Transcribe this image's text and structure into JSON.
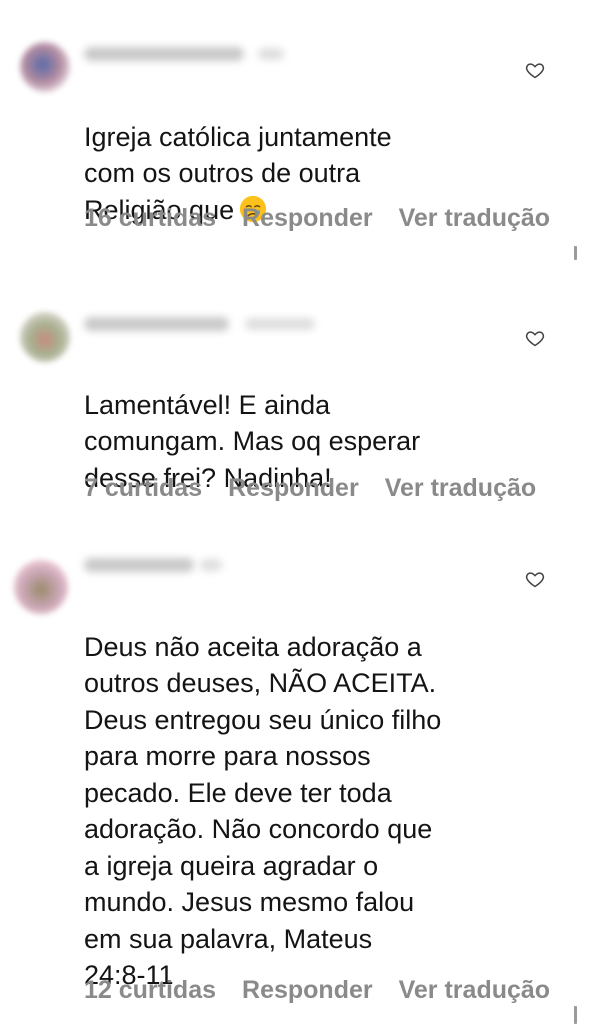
{
  "comments": [
    {
      "text": "Igreja católica juntamente\ncom os outros de outra\nReligião que",
      "emoji": "crying-face-emoji",
      "likes": "16 curtidas",
      "reply": "Responder",
      "translate": "Ver tradução"
    },
    {
      "text": "Lamentável! E ainda\ncomungam. Mas oq esperar\ndesse frei? Nadinha!",
      "likes": "7 curtidas",
      "reply": "Responder",
      "translate": "Ver tradução"
    },
    {
      "text": "Deus não aceita adoração a\noutros deuses, NÃO ACEITA.\nDeus entregou seu único filho\npara morre para nossos\npecado. Ele deve ter toda\nadoração. Não concordo que\na igreja queira agradar o\nmundo. Jesus mesmo falou\nem sua palavra, Mateus\n24:8-11",
      "likes": "12 curtidas",
      "reply": "Responder",
      "translate": "Ver tradução"
    }
  ],
  "icons": {
    "like": "heart-outline-icon",
    "avatar": "blurred-avatar"
  },
  "colors": {
    "text": "#141414",
    "meta": "#8a8a8a",
    "background": "#ffffff"
  }
}
